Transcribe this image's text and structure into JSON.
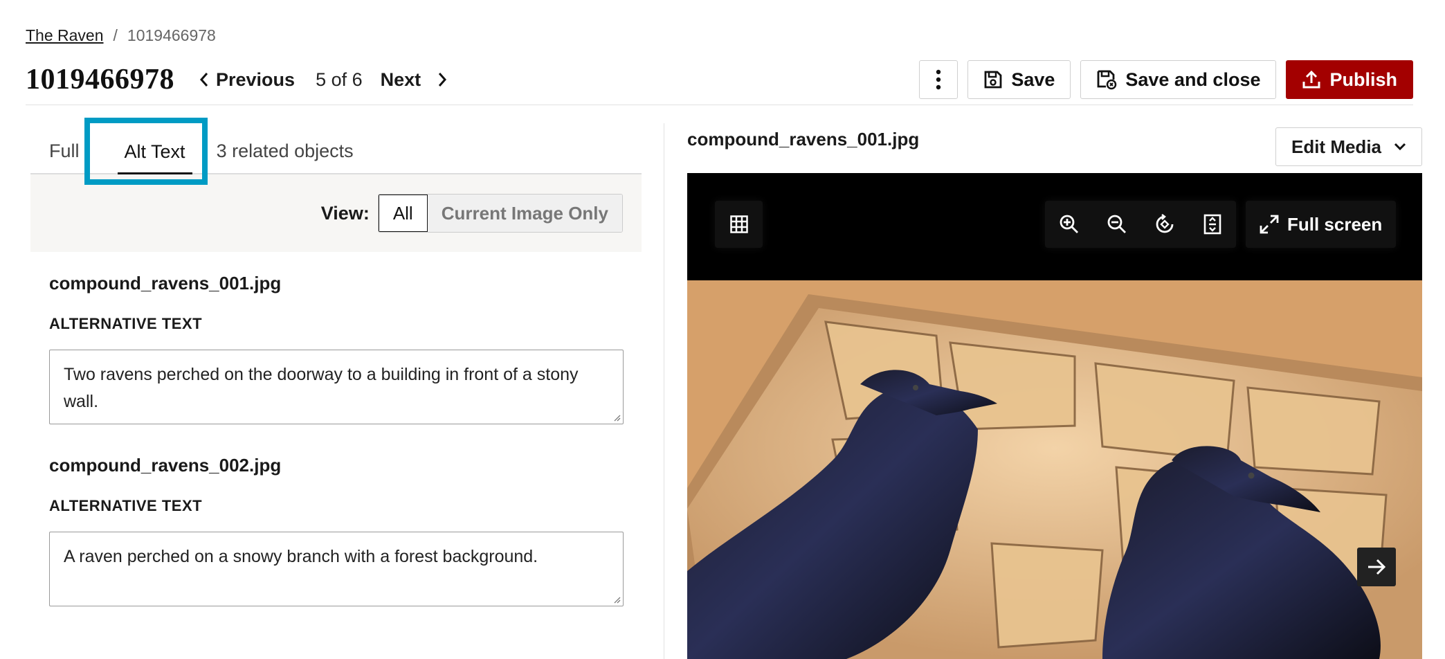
{
  "breadcrumb": {
    "parent": "The Raven",
    "separator": "/",
    "current": "1019466978"
  },
  "header": {
    "title": "1019466978",
    "previous_label": "Previous",
    "position_label": "5 of 6",
    "next_label": "Next",
    "save_label": "Save",
    "save_close_label": "Save and close",
    "publish_label": "Publish"
  },
  "tabs": [
    {
      "label": "Full"
    },
    {
      "label": "Alt Text",
      "selected": true
    },
    {
      "label": "3 related objects"
    }
  ],
  "view_filter": {
    "label": "View:",
    "options": [
      "All",
      "Current Image Only"
    ],
    "selected": "All"
  },
  "alt_items": [
    {
      "filename": "compound_ravens_001.jpg",
      "field_label": "ALTERNATIVE TEXT",
      "value": "Two ravens perched on the doorway to a building in front of a stony wall."
    },
    {
      "filename": "compound_ravens_002.jpg",
      "field_label": "ALTERNATIVE TEXT",
      "value": "A raven perched on a snowy branch with a forest background."
    }
  ],
  "media": {
    "filename": "compound_ravens_001.jpg",
    "edit_label": "Edit Media",
    "fullscreen_label": "Full screen"
  },
  "colors": {
    "publish": "#a30000",
    "focus": "#009bc4"
  }
}
